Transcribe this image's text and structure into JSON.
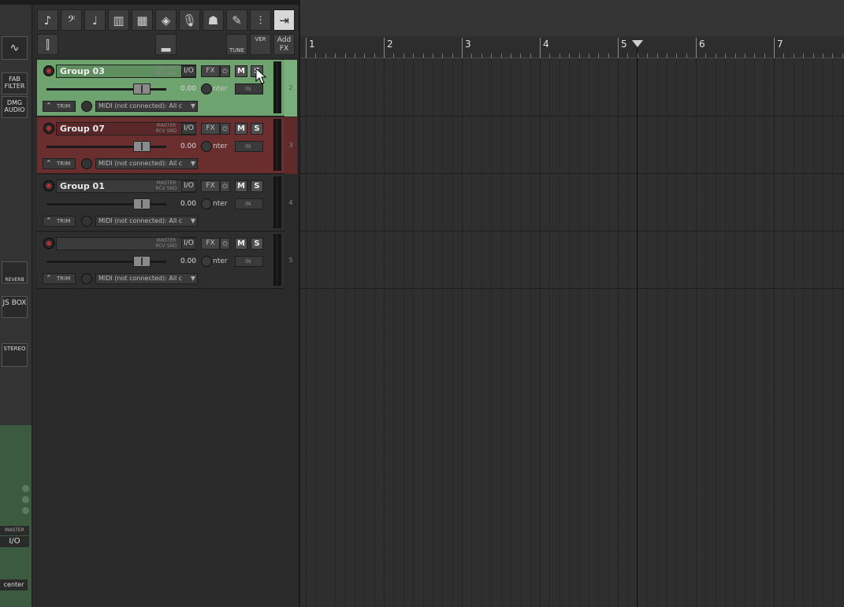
{
  "left_dock": {
    "buttons": [
      "FAB FILTER",
      "DMG AUDIO",
      "REVERB",
      "JS BOX",
      "STEREO"
    ],
    "io": {
      "master_label": "MASTER",
      "io_label": "I/O"
    },
    "pan_label": "center"
  },
  "toolbar": {
    "row1_icons": [
      "drum-kit-icon",
      "bass-clef-icon",
      "guitar-icon",
      "piano-keys-icon",
      "synth-icon",
      "keyboard-icon",
      "microphone-icon",
      "vocalist-icon",
      "pencil-icon",
      "eq-icon",
      "arrow-right-icon"
    ],
    "tune_label": "TUNE",
    "ver_label": "VER",
    "add_fx_label": "Add FX"
  },
  "tracks": [
    {
      "name": "Group 03",
      "number": "2",
      "color": "#6ea26e",
      "volume": "0.00",
      "pan": "nter",
      "fx": "FX",
      "mute": "M",
      "solo": "S",
      "io": "I/O",
      "trim": "TRIM",
      "input": "IN",
      "midi_input": "MIDI (not connected): All c",
      "master_send": "MASTER",
      "snd": "RCV SND"
    },
    {
      "name": "Group 07",
      "number": "3",
      "color": "#6b2e2e",
      "volume": "0.00",
      "pan": "nter",
      "fx": "FX",
      "mute": "M",
      "solo": "S",
      "io": "I/O",
      "trim": "TRIM",
      "input": "IN",
      "midi_input": "MIDI (not connected): All c",
      "master_send": "MASTER",
      "snd": "RCV SND"
    },
    {
      "name": "Group 01",
      "number": "4",
      "color": "#2e2e2e",
      "volume": "0.00",
      "pan": "nter",
      "fx": "FX",
      "mute": "M",
      "solo": "S",
      "io": "I/O",
      "trim": "TRIM",
      "input": "IN",
      "midi_input": "MIDI (not connected): All c",
      "master_send": "MASTER",
      "snd": "RCV SND"
    },
    {
      "name": "",
      "number": "5",
      "color": "#2e2e2e",
      "volume": "0.00",
      "pan": "nter",
      "fx": "FX",
      "mute": "M",
      "solo": "S",
      "io": "I/O",
      "trim": "TRIM",
      "input": "IN",
      "midi_input": "MIDI (not connected): All c",
      "master_send": "MASTER",
      "snd": "RCV SND"
    }
  ],
  "ruler": {
    "bars": [
      "1",
      "2",
      "3",
      "4",
      "5",
      "6",
      "7"
    ]
  }
}
